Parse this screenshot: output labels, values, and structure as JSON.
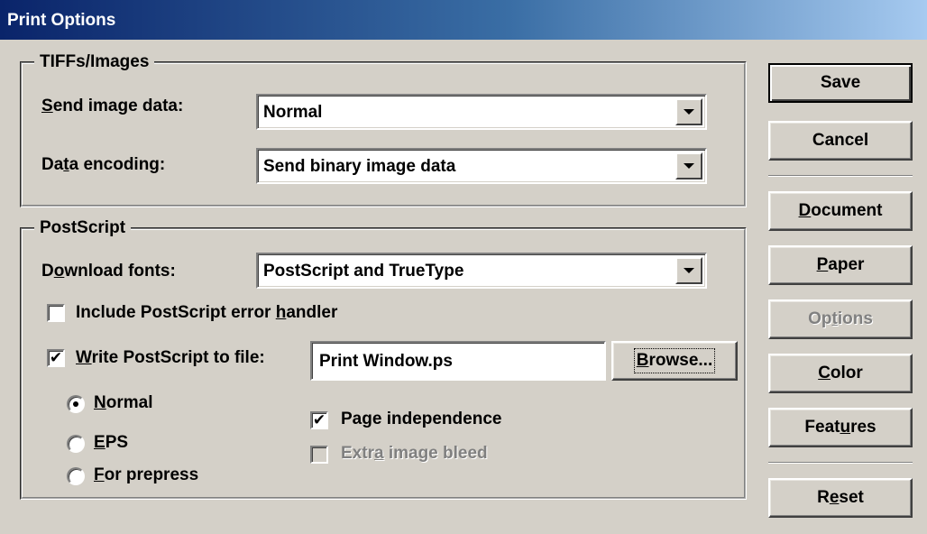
{
  "window": {
    "title": "Print Options"
  },
  "tiffs": {
    "legend": "TIFFs/Images",
    "send_image_label_pre": "",
    "send_image_label_u": "S",
    "send_image_label_post": "end image data:",
    "send_image_value": "Normal",
    "encoding_label_pre": "Da",
    "encoding_label_u": "t",
    "encoding_label_post": "a encoding:",
    "encoding_value": "Send binary image data"
  },
  "postscript": {
    "legend": "PostScript",
    "fonts_label_pre": "D",
    "fonts_label_u": "o",
    "fonts_label_post": "wnload fonts:",
    "fonts_value": "PostScript and TrueType",
    "error_handler_pre": "Include PostScript error ",
    "error_handler_u": "h",
    "error_handler_post": "andler",
    "error_handler_checked": false,
    "write_file_pre": "",
    "write_file_u": "W",
    "write_file_post": "rite PostScript to file:",
    "write_file_checked": true,
    "file_name": "Print Window.ps",
    "browse_pre": "",
    "browse_u": "B",
    "browse_post": "rowse...",
    "radio_normal_u": "N",
    "radio_normal_post": "ormal",
    "radio_eps_u": "E",
    "radio_eps_post": "PS",
    "radio_prepress_u": "F",
    "radio_prepress_post": "or prepress",
    "selected_mode": "Normal",
    "page_indep_pre": "Pa",
    "page_indep_u": "g",
    "page_indep_post": "e independence",
    "page_indep_checked": true,
    "bleed_pre": "Extr",
    "bleed_u": "a",
    "bleed_post": " image bleed",
    "bleed_checked": false,
    "check_mark": "✔"
  },
  "buttons": {
    "save": "Save",
    "cancel": "Cancel",
    "document_u": "D",
    "document_post": "ocument",
    "paper_u": "P",
    "paper_post": "aper",
    "options_pre": "Op",
    "options_u": "t",
    "options_post": "ions",
    "color_u": "C",
    "color_post": "olor",
    "features_pre": "Feat",
    "features_u": "u",
    "features_post": "res",
    "reset_pre": "R",
    "reset_u": "e",
    "reset_post": "set"
  },
  "colors": {
    "face": "#d4d0c8",
    "title_start": "#0a246a",
    "title_end": "#a6caf0"
  }
}
